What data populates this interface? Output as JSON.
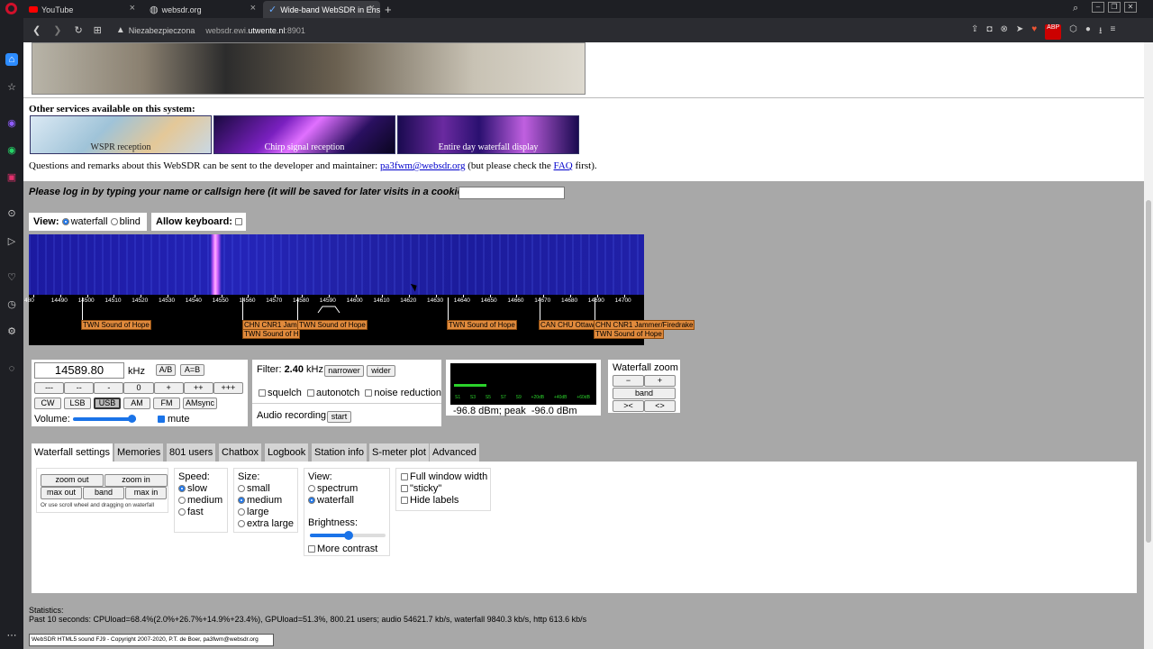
{
  "browser": {
    "tabs": [
      {
        "label": "YouTube",
        "icon": "youtube-icon"
      },
      {
        "label": "websdr.org",
        "icon": "globe-icon"
      },
      {
        "label": "Wide-band WebSDR in Ens",
        "icon": "websdr-icon"
      }
    ],
    "security_label": "Niezabezpieczona",
    "url_prefix": "websdr.ewi.",
    "url_domain": "utwente.nl",
    "url_suffix": ":8901",
    "colors": {
      "accent": "#1a73e8",
      "dark": "#1e1f24"
    }
  },
  "services": {
    "heading": "Other services available on this system:",
    "items": [
      "WSPR reception",
      "Chirp signal reception",
      "Entire day waterfall display"
    ]
  },
  "contact": {
    "before": "Questions and remarks about this WebSDR can be sent to the developer and maintainer:",
    "email": "pa3fwm@websdr.org",
    "middle": "(but please check the",
    "faq": "FAQ",
    "after": "first)."
  },
  "login": {
    "prompt": "Please log in by typing your name or callsign here (it will be saved for later visits in a cookie):",
    "value": ""
  },
  "view": {
    "label": "View:",
    "opt1": "waterfall",
    "opt2": "blind",
    "selected": "waterfall",
    "keyboard": "Allow keyboard:"
  },
  "waterfall": {
    "freqs": [
      "480",
      "14490",
      "14500",
      "14510",
      "14520",
      "14530",
      "14540",
      "14550",
      "14560",
      "14570",
      "14580",
      "14590",
      "14600",
      "14610",
      "14620",
      "14630",
      "14640",
      "14650",
      "14660",
      "14670",
      "14680",
      "14690",
      "14700"
    ],
    "markers": [
      {
        "text": "TWN Sound of Hope"
      },
      {
        "text": "CHN CNR1 Jam"
      },
      {
        "text": "TWN Sound of H"
      },
      {
        "text": "TWN Sound of Hope"
      },
      {
        "text": "TWN Sound of Hope"
      },
      {
        "text": "CAN CHU Ottaw"
      },
      {
        "text": "CHN CNR1 Jammer/Firedrake"
      },
      {
        "text": "TWN Sound of Hope"
      }
    ]
  },
  "tuner": {
    "freq": "14589.80",
    "unit": "kHz",
    "ab": "A/B",
    "aeqb": "A=B",
    "steps": [
      "---",
      "--",
      "-",
      "0",
      "+",
      "++",
      "+++"
    ],
    "modes": [
      "CW",
      "LSB",
      "USB",
      "AM",
      "FM",
      "AMsync"
    ],
    "active_mode": "USB",
    "volume_label": "Volume:",
    "volume": 0.85,
    "mute": "mute"
  },
  "filter": {
    "label": "Filter:",
    "value": "2.40",
    "unit": "kHz",
    "narrower": "narrower",
    "wider": "wider",
    "squelch": "squelch",
    "autonotch": "autonotch",
    "nr": "noise reduction",
    "rec_label": "Audio recording",
    "rec_start": "start"
  },
  "smeter": {
    "scale": [
      "S1",
      "S3",
      "S5",
      "S7",
      "S9",
      "+20dB",
      "+40dB",
      "+60dB"
    ],
    "readout": "-96.8 dBm; peak  -96.0 dBm",
    "level": 0.2
  },
  "wfzoom": {
    "title": "Waterfall zoom",
    "minus": "−",
    "plus": "+",
    "band": "band",
    "narrow": "><",
    "wide": "<>"
  },
  "lower_tabs": [
    "Waterfall settings",
    "Memories",
    "801 users",
    "Chatbox",
    "Logbook",
    "Station info",
    "S-meter plot",
    "Advanced"
  ],
  "settings": {
    "zoom_out": "zoom out",
    "zoom_in": "zoom in",
    "max_out": "max out",
    "band": "band",
    "max_in": "max in",
    "hint": "Or use scroll wheel and dragging on waterfall",
    "speed": {
      "label": "Speed:",
      "options": [
        "slow",
        "medium",
        "fast"
      ],
      "selected": "slow"
    },
    "size": {
      "label": "Size:",
      "options": [
        "small",
        "medium",
        "large",
        "extra large"
      ],
      "selected": "medium"
    },
    "view": {
      "label": "View:",
      "options": [
        "spectrum",
        "waterfall"
      ],
      "selected": "waterfall"
    },
    "brightness": {
      "label": "Brightness:",
      "value": 0.55
    },
    "more_contrast": "More contrast",
    "checks": [
      "Full window width",
      "\"sticky\"",
      "Hide labels"
    ]
  },
  "stats": {
    "label": "Statistics:",
    "line": "Past 10 seconds: CPUload=68.4%(2.0%+26.7%+14.9%+23.4%), GPUload=51.3%, 800.21 users; audio 54621.7 kb/s, waterfall 9840.3 kb/s, http 613.6 kb/s"
  },
  "footer": "WebSDR HTML5 sound FJ9 - Copyright 2007-2020, P.T. de Boer, pa3fwm@websdr.org"
}
